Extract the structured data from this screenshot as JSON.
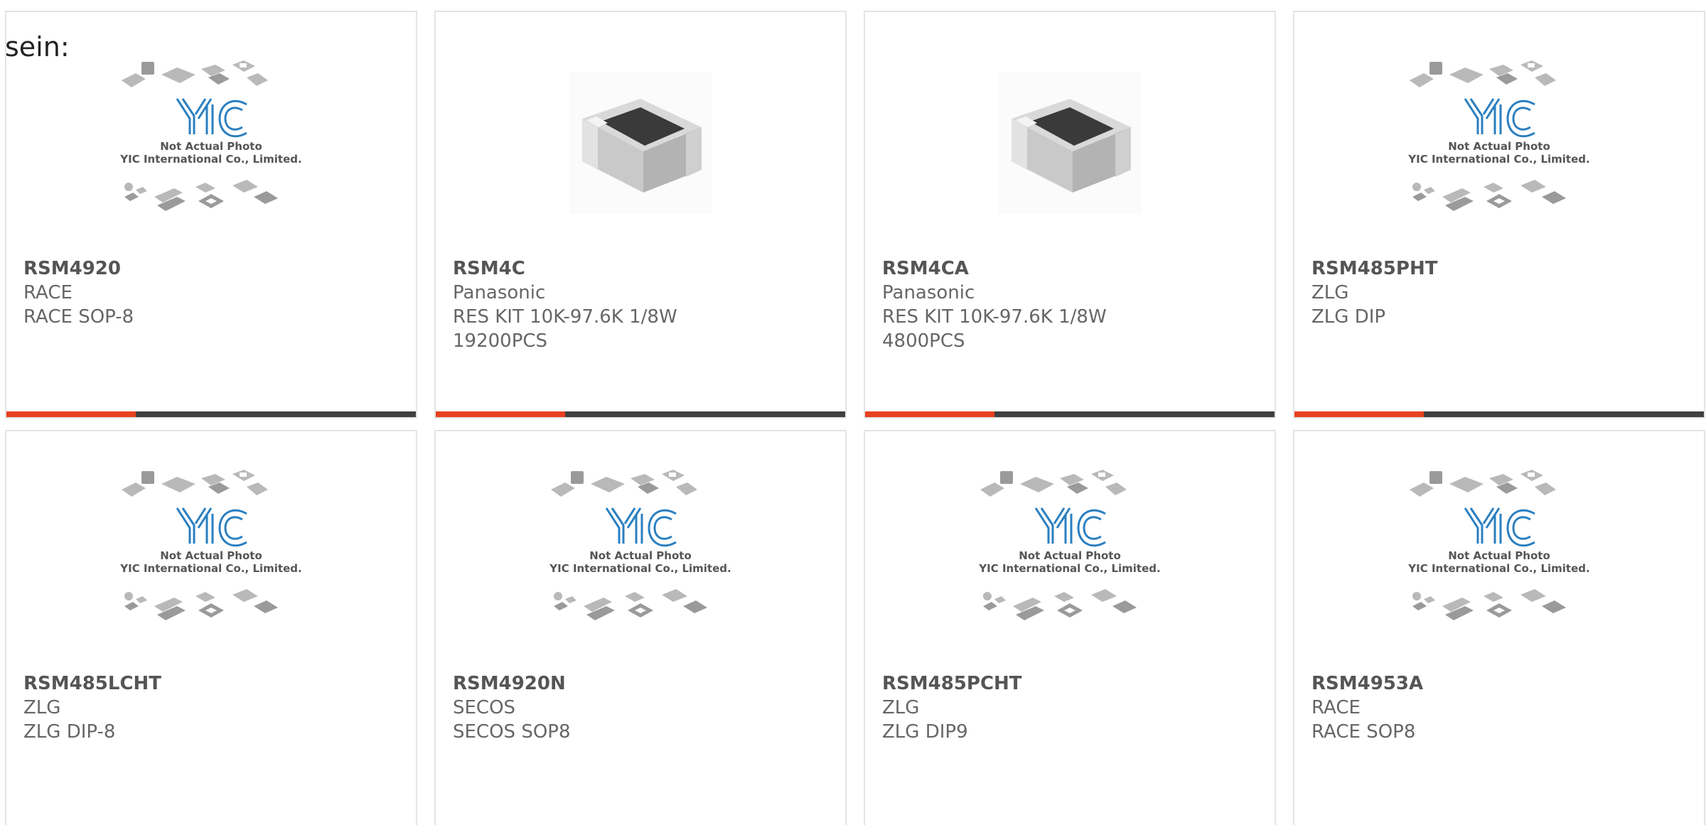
{
  "intro_text": "sein:",
  "placeholder": {
    "line1": "Not Actual Photo",
    "line2": "YIC International Co., Limited.",
    "logo": "YIC"
  },
  "colors": {
    "accent": "#e8411e",
    "bar": "#3f3f3f",
    "logo_blue": "#2a7fc0",
    "text": "#666666"
  },
  "products": [
    {
      "part": "RSM4920",
      "maker": "RACE",
      "desc": "RACE SOP-8",
      "extra": "",
      "image": "placeholder"
    },
    {
      "part": "RSM4C",
      "maker": "Panasonic",
      "desc": "RES KIT 10K-97.6K 1/8W",
      "extra": "19200PCS",
      "image": "smd-resistor"
    },
    {
      "part": "RSM4CA",
      "maker": "Panasonic",
      "desc": "RES KIT 10K-97.6K 1/8W",
      "extra": "4800PCS",
      "image": "smd-resistor"
    },
    {
      "part": "RSM485PHT",
      "maker": "ZLG",
      "desc": "ZLG DIP",
      "extra": "",
      "image": "placeholder"
    },
    {
      "part": "RSM485LCHT",
      "maker": "ZLG",
      "desc": "ZLG DIP-8",
      "extra": "",
      "image": "placeholder"
    },
    {
      "part": "RSM4920N",
      "maker": "SECOS",
      "desc": "SECOS SOP8",
      "extra": "",
      "image": "placeholder"
    },
    {
      "part": "RSM485PCHT",
      "maker": "ZLG",
      "desc": "ZLG DIP9",
      "extra": "",
      "image": "placeholder"
    },
    {
      "part": "RSM4953A",
      "maker": "RACE",
      "desc": "RACE SOP8",
      "extra": "",
      "image": "placeholder"
    }
  ]
}
